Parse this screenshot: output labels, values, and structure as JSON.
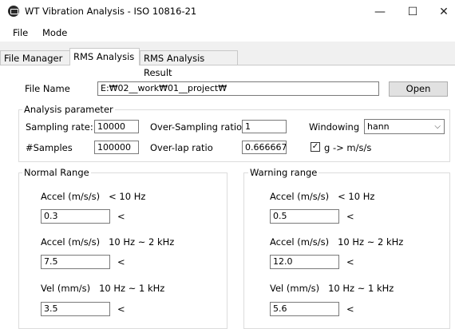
{
  "window": {
    "title": "WT Vibration Analysis - ISO 10816-21",
    "minimize_glyph": "—",
    "maximize_glyph": "☐",
    "close_glyph": "✕"
  },
  "menu": {
    "items": [
      "File",
      "Mode"
    ]
  },
  "tabs": [
    {
      "label": "File Manager"
    },
    {
      "label": "RMS Analysis"
    },
    {
      "label": "RMS Analysis Result"
    }
  ],
  "file": {
    "label": "File Name",
    "value": "E:₩02__work₩01__project₩",
    "open_label": "Open"
  },
  "analysis": {
    "legend": "Analysis parameter",
    "sampling_rate_label": "Sampling rate:",
    "sampling_rate_value": "10000",
    "oversampling_label": "Over-Sampling ratio",
    "oversampling_value": "1",
    "windowing_label": "Windowing",
    "windowing_value": "hann",
    "samples_label": "#Samples",
    "samples_value": "100000",
    "overlap_label": "Over-lap ratio",
    "overlap_value": "0.666667",
    "g_checkbox_label": "g -> m/s/s",
    "g_checkbox_checked": true
  },
  "normal": {
    "legend": "Normal Range",
    "accel_low_label": "Accel (m/s/s)   < 10 Hz",
    "accel_low_value": "0.3",
    "accel_mid_label": "Accel (m/s/s)   10 Hz ~ 2 kHz",
    "accel_mid_value": "7.5",
    "vel_label": "Vel (mm/s)   10 Hz ~ 1 kHz",
    "vel_value": "3.5",
    "lt": "<"
  },
  "warning": {
    "legend": "Warning range",
    "accel_low_label": "Accel (m/s/s)   < 10 Hz",
    "accel_low_value": "0.5",
    "accel_mid_label": "Accel (m/s/s)   10 Hz ~ 2 kHz",
    "accel_mid_value": "12.0",
    "vel_label": "Vel (mm/s)   10 Hz ~ 1 kHz",
    "vel_value": "5.6",
    "lt": "<"
  },
  "colors": {
    "accent": "#000000",
    "tab_bg": "#f0f0f0",
    "border": "#7a7a7a"
  }
}
